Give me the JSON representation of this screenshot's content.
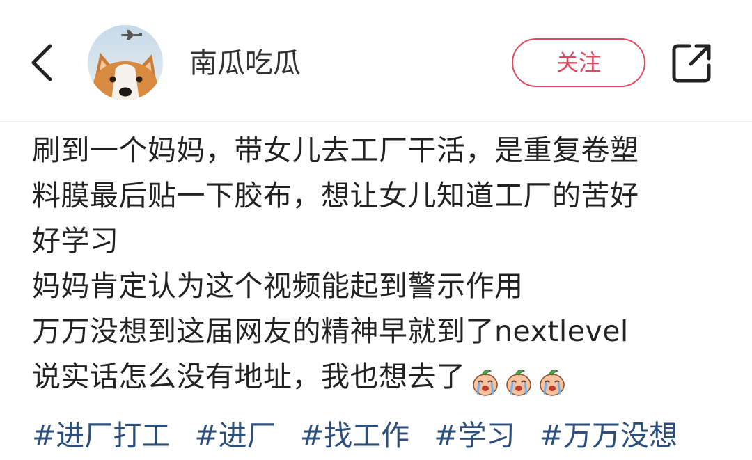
{
  "header": {
    "username": "南瓜吃瓜",
    "follow_label": "关注",
    "back_icon": "chevron-left-icon",
    "share_icon": "share-icon",
    "avatar": "corgi-avatar-with-airplane"
  },
  "post": {
    "lines": [
      "刷到一个妈妈，带女儿去工厂干活，是重复卷塑",
      "料膜最后贴一下胶布，想让女儿知道工厂的苦好",
      "好学习",
      "妈妈肯定认为这个视频能起到警示作用",
      "万万没想到这届网友的精神早就到了nextlevel",
      "说实话怎么没有地址，我也想去了"
    ],
    "emoji_count": 3,
    "emoji_name": "crying-peach-emoji"
  },
  "tags": [
    "#进厂打工",
    "#进厂",
    "#找工作",
    "#学习",
    "#万万没想"
  ],
  "colors": {
    "accent": "#e0485c",
    "tag": "#2c4f7c",
    "text": "#222222"
  }
}
